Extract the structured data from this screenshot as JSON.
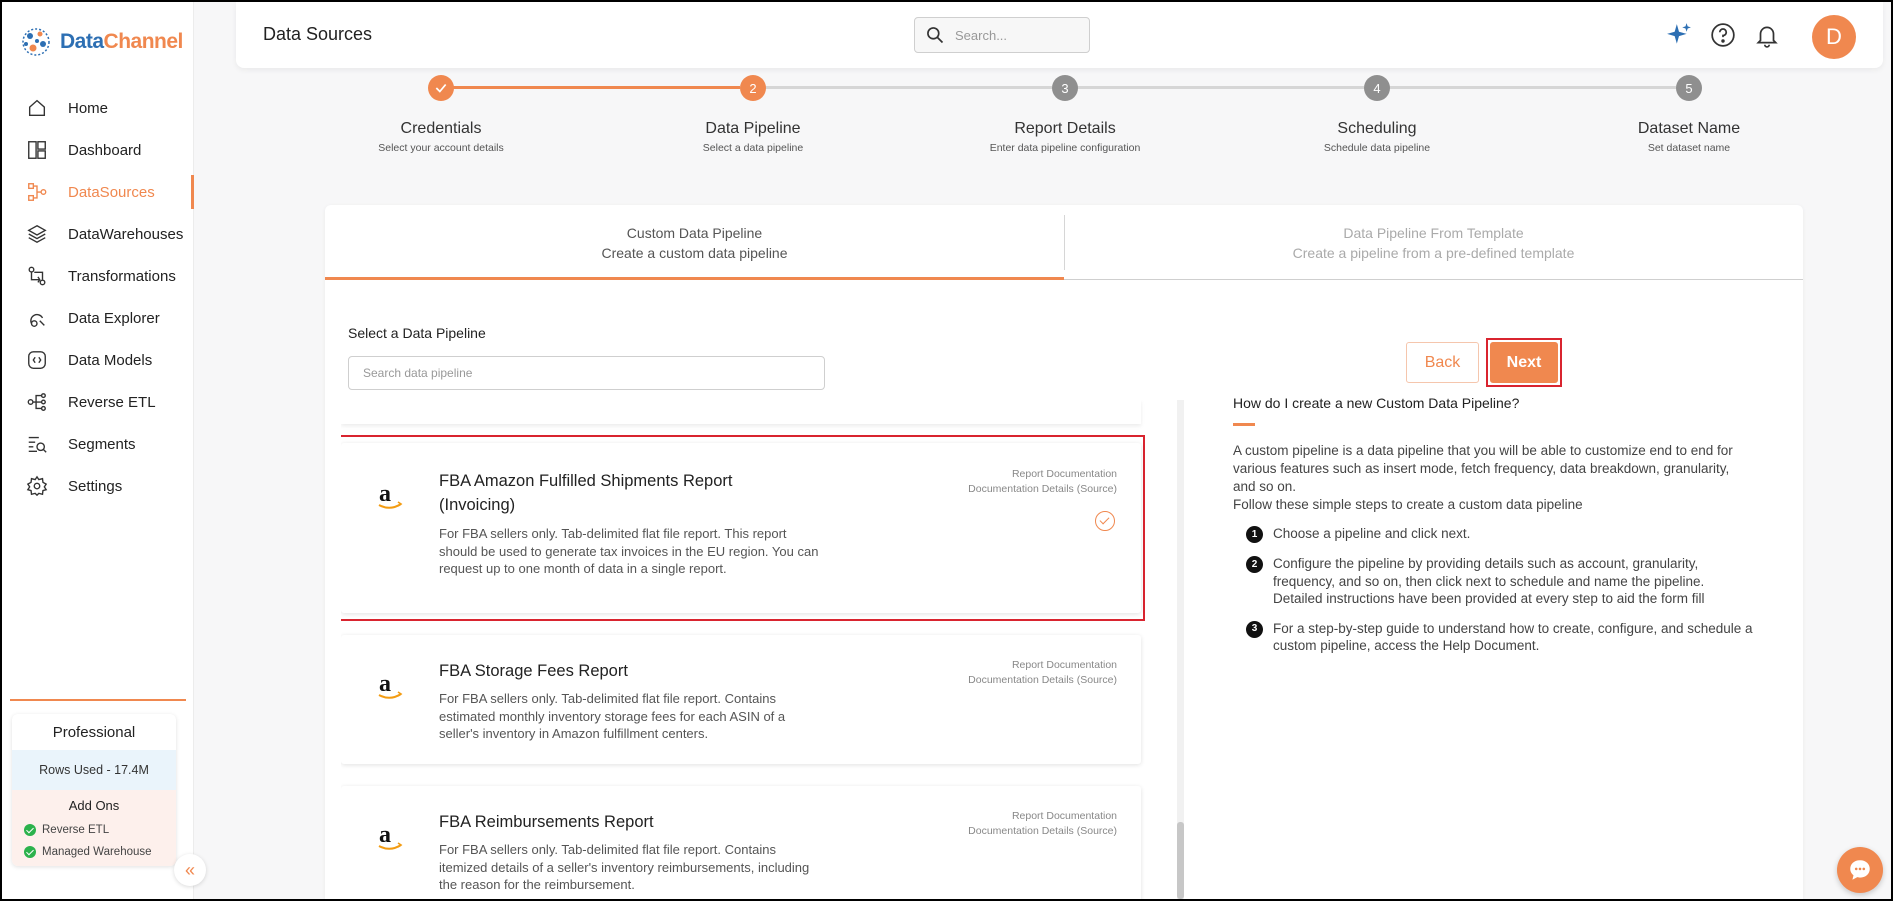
{
  "brand": {
    "name_part1": "Data",
    "name_part2": "Channel"
  },
  "sidebar": {
    "items": [
      {
        "label": "Home",
        "icon": "home-icon"
      },
      {
        "label": "Dashboard",
        "icon": "dashboard-icon"
      },
      {
        "label": "DataSources",
        "icon": "datasources-icon",
        "active": true
      },
      {
        "label": "DataWarehouses",
        "icon": "layers-icon"
      },
      {
        "label": "Transformations",
        "icon": "transform-icon"
      },
      {
        "label": "Data Explorer",
        "icon": "explorer-icon"
      },
      {
        "label": "Data Models",
        "icon": "models-icon"
      },
      {
        "label": "Reverse ETL",
        "icon": "reverse-etl-icon"
      },
      {
        "label": "Segments",
        "icon": "segments-icon"
      },
      {
        "label": "Settings",
        "icon": "gear-icon"
      }
    ],
    "plan": {
      "title": "Professional",
      "rows_used": "Rows Used - 17.4M",
      "addons_title": "Add Ons",
      "addons": [
        "Reverse ETL",
        "Managed Warehouse"
      ]
    },
    "collapse_glyph": "«"
  },
  "header": {
    "title": "Data Sources",
    "search_placeholder": "Search...",
    "avatar_letter": "D"
  },
  "stepper": {
    "steps": [
      {
        "name": "Credentials",
        "sub": "Select your account details",
        "marker": "",
        "state": "done"
      },
      {
        "name": "Data Pipeline",
        "sub": "Select a data pipeline",
        "marker": "2",
        "state": "active"
      },
      {
        "name": "Report Details",
        "sub": "Enter data pipeline configuration",
        "marker": "3",
        "state": "pending"
      },
      {
        "name": "Scheduling",
        "sub": "Schedule data pipeline",
        "marker": "4",
        "state": "pending"
      },
      {
        "name": "Dataset Name",
        "sub": "Set dataset name",
        "marker": "5",
        "state": "pending"
      }
    ]
  },
  "tabs": [
    {
      "title": "Custom Data Pipeline",
      "sub": "Create a custom data pipeline",
      "active": true
    },
    {
      "title": "Data Pipeline From Template",
      "sub": "Create a pipeline from a pre-defined template",
      "active": false
    }
  ],
  "pipeline_select": {
    "label": "Select a Data Pipeline",
    "search_placeholder": "Search data pipeline",
    "back_label": "Back",
    "next_label": "Next"
  },
  "pipelines": [
    {
      "title": "FBA Amazon Fulfilled Shipments Report (Invoicing)",
      "desc": "For FBA sellers only. Tab-delimited flat file report. This report should be used to generate tax invoices in the EU region. You can request up to one month of data in a single report.",
      "link1": "Report Documentation",
      "link2": "Documentation Details (Source)",
      "selected": true
    },
    {
      "title": "FBA Storage Fees Report",
      "desc": "For FBA sellers only. Tab-delimited flat file report. Contains estimated monthly inventory storage fees for each ASIN of a seller's inventory in Amazon fulfillment centers.",
      "link1": "Report Documentation",
      "link2": "Documentation Details (Source)",
      "selected": false
    },
    {
      "title": "FBA Reimbursements Report",
      "desc": "For FBA sellers only. Tab-delimited flat file report. Contains itemized details of a seller's inventory reimbursements, including the reason for the reimbursement.",
      "link1": "Report Documentation",
      "link2": "Documentation Details (Source)",
      "selected": false
    }
  ],
  "help": {
    "title": "How do I create a new Custom Data Pipeline?",
    "para1": "A custom pipeline is a data pipeline that you will be able to customize end to end for various features such as insert mode, fetch frequency, data breakdown, granularity, and so on.",
    "para2": "Follow these simple steps to create a custom data pipeline",
    "steps": [
      {
        "num": "1",
        "text": "Choose a pipeline and click next."
      },
      {
        "num": "2",
        "text": "Configure the pipeline by providing details such as account, granularity, frequency, and so on, then click next to schedule and name the pipeline. Detailed instructions have been provided at every step to aid the form fill"
      },
      {
        "num": "3",
        "text": "For a step-by-step guide to understand how to create, configure, and schedule a custom pipeline, access the Help Document."
      }
    ]
  },
  "colors": {
    "accent": "#f0884f",
    "brand_blue": "#2d6fb3",
    "highlight": "#d9242f",
    "success": "#2bb24c"
  }
}
